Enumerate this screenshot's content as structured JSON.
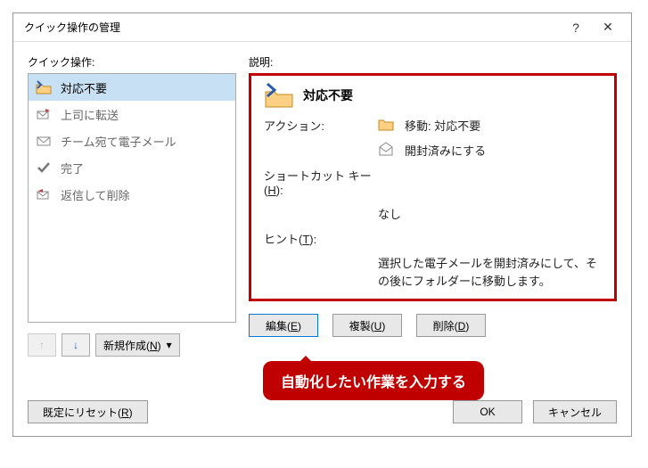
{
  "dialog": {
    "title": "クイック操作の管理",
    "help": "?",
    "close": "✕"
  },
  "left": {
    "label": "クイック操作:",
    "items": [
      {
        "label": "対応不要",
        "icon": "folder-arrow"
      },
      {
        "label": "上司に転送",
        "icon": "forward"
      },
      {
        "label": "チーム宛て電子メール",
        "icon": "mail"
      },
      {
        "label": "完了",
        "icon": "check"
      },
      {
        "label": "返信して削除",
        "icon": "reply-delete"
      }
    ],
    "up": "↑",
    "down": "↓",
    "new_btn": "新規作成(N)"
  },
  "right": {
    "label": "説明:",
    "title": "対応不要",
    "rows": {
      "action_label": "アクション:",
      "action1": "移動: 対応不要",
      "action2": "開封済みにする",
      "shortcut_label": "ショートカット キー(H):",
      "shortcut_val": "なし",
      "hint_label": "ヒント(T):",
      "hint_val": "選択した電子メールを開封済みにして、その後にフォルダーに移動します。"
    },
    "buttons": {
      "edit": "編集(E)",
      "dup": "複製(U)",
      "del": "削除(D)"
    }
  },
  "callout": "自動化したい作業を入力する",
  "footer": {
    "reset": "既定にリセット(R)",
    "ok": "OK",
    "cancel": "キャンセル"
  }
}
